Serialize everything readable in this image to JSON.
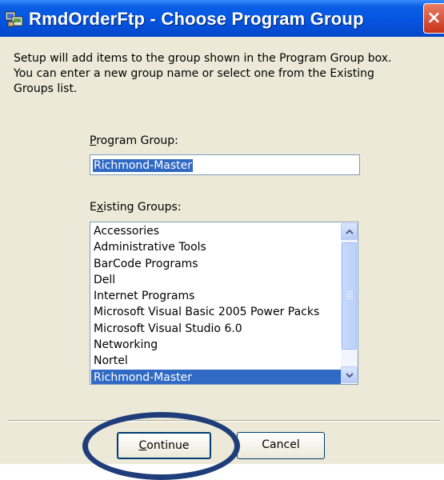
{
  "window": {
    "title": "RmdOrderFtp - Choose Program Group",
    "close_glyph": "×"
  },
  "intro_text": "Setup will add items to the group shown in the Program Group box.\nYou can enter a new group name or select one from the Existing\nGroups list.",
  "program_group": {
    "label_access_key": "P",
    "label_rest": "rogram Group:",
    "value": "Richmond-Master"
  },
  "existing_groups": {
    "label_first": "E",
    "label_access_key": "x",
    "label_rest": "isting Groups:",
    "items": [
      {
        "label": "Accessories"
      },
      {
        "label": "Administrative Tools"
      },
      {
        "label": "BarCode Programs"
      },
      {
        "label": "Dell"
      },
      {
        "label": "Internet Programs"
      },
      {
        "label": "Microsoft Visual Basic 2005 Power Packs"
      },
      {
        "label": "Microsoft Visual Studio 6.0"
      },
      {
        "label": "Networking"
      },
      {
        "label": "Nortel"
      },
      {
        "label": "Richmond-Master"
      }
    ],
    "selected_index": 9
  },
  "buttons": {
    "continue_access_key": "C",
    "continue_rest": "ontinue",
    "cancel": "Cancel"
  },
  "colors": {
    "titlebar": "#0554e1",
    "selection": "#316ac5",
    "dialog_bg": "#ece9d8",
    "annotation_ring": "#1f3d7a"
  }
}
